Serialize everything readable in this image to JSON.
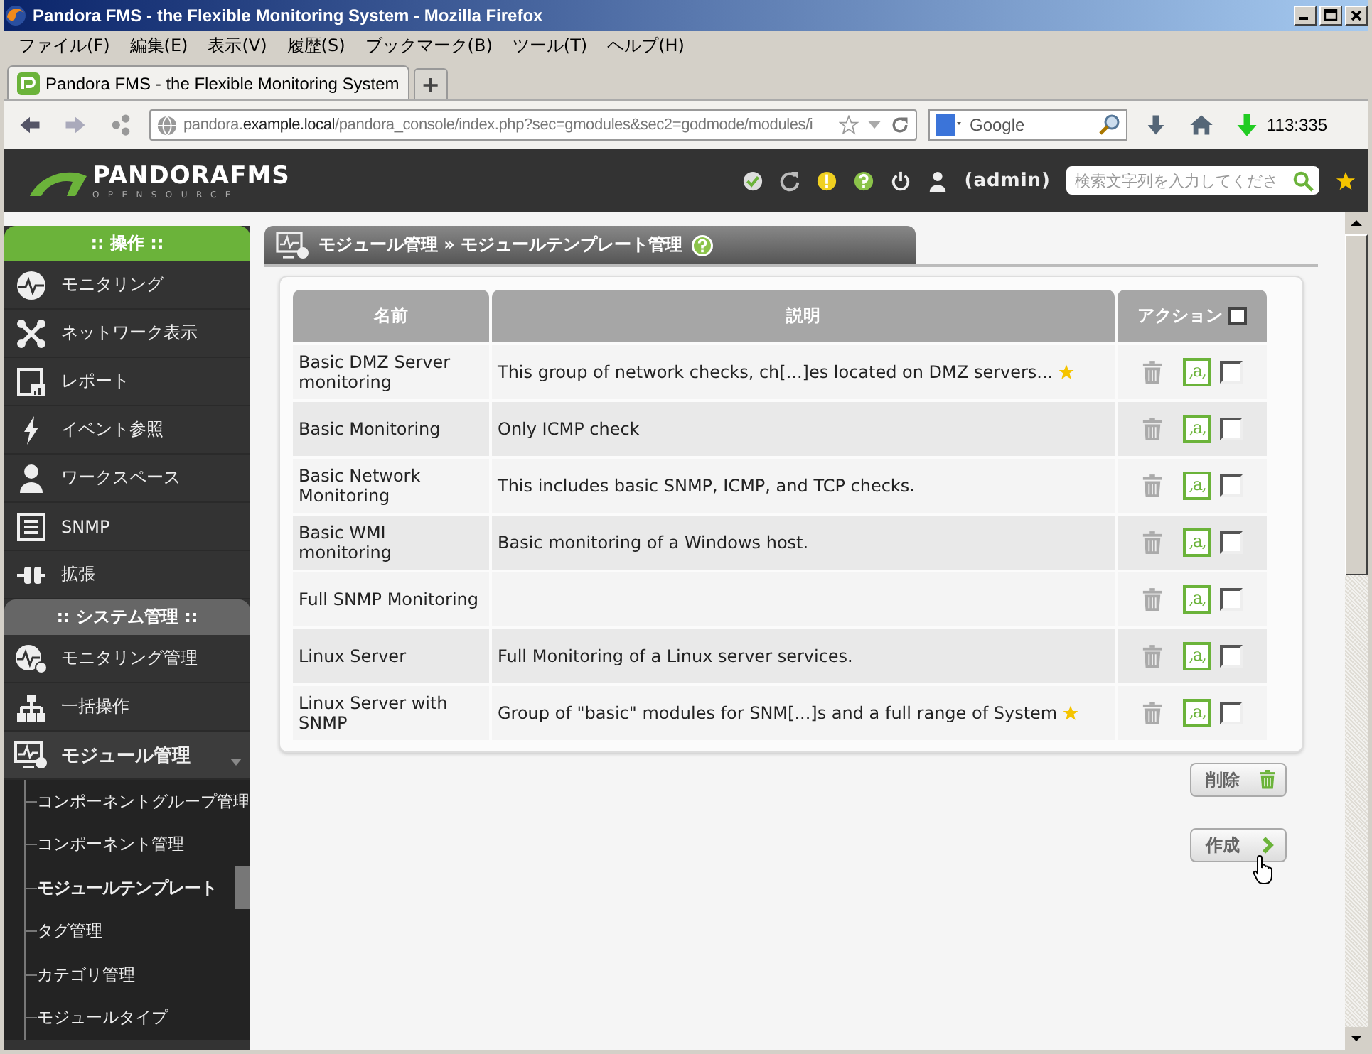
{
  "window": {
    "title": "Pandora FMS - the Flexible Monitoring System - Mozilla Firefox"
  },
  "menu_bar": [
    "ファイル(F)",
    "編集(E)",
    "表示(V)",
    "履歴(S)",
    "ブックマーク(B)",
    "ツール(T)",
    "ヘルプ(H)"
  ],
  "tabs": [
    {
      "label": "Pandora FMS - the Flexible Monitoring System",
      "selected": true
    }
  ],
  "new_tab": "+",
  "address_bar": {
    "prefix": "pandora.",
    "domain": "example.local",
    "path": "/pandora_console/index.php?sec=gmodules&sec2=godmode/modules/i"
  },
  "search_bar": {
    "placeholder": "Google"
  },
  "counter": "113:335",
  "header": {
    "logo": "PANDORAFMS",
    "logo_sub": "OPENSOURCE",
    "user": "(admin)",
    "search_placeholder": "検索文字列を入力してくださ"
  },
  "sidebar": [
    {
      "title": ":: 操作 ::",
      "selected": true,
      "items": [
        {
          "label": "モニタリング",
          "expanded": false
        },
        {
          "label": "ネットワーク表示",
          "expanded": false
        },
        {
          "label": "レポート",
          "expanded": false
        },
        {
          "label": "イベント参照",
          "expanded": false
        },
        {
          "label": "ワークスペース",
          "expanded": false
        },
        {
          "label": "SNMP",
          "expanded": false
        },
        {
          "label": "拡張",
          "expanded": false
        }
      ]
    },
    {
      "title": ":: システム管理 ::",
      "selected": false,
      "items": [
        {
          "label": "モニタリング管理",
          "expanded": false
        },
        {
          "label": "一括操作",
          "expanded": false
        },
        {
          "label": "モジュール管理",
          "expanded": true,
          "children": [
            {
              "label": "コンポーネントグループ管理",
              "selected": false
            },
            {
              "label": "コンポーネント管理",
              "selected": false
            },
            {
              "label": "モジュールテンプレート",
              "selected": true
            },
            {
              "label": "タグ管理",
              "selected": false
            },
            {
              "label": "カテゴリ管理",
              "selected": false
            },
            {
              "label": "モジュールタイプ",
              "selected": false
            }
          ]
        }
      ]
    }
  ],
  "page_title": "モジュール管理 » モジュールテンプレート管理",
  "table": {
    "columns": [
      "名前",
      "説明",
      "アクション"
    ],
    "select_all_checked": false,
    "rows": [
      {
        "name": "Basic DMZ Server monitoring",
        "description": "This group of network checks, ch[...]es located on DMZ servers...",
        "star": true,
        "edit": ",a,",
        "checked": false
      },
      {
        "name": "Basic Monitoring",
        "description": "Only ICMP check",
        "star": false,
        "edit": ",a,",
        "checked": false
      },
      {
        "name": "Basic Network Monitoring",
        "description": "This includes basic SNMP, ICMP, and TCP checks.",
        "star": false,
        "edit": ",a,",
        "checked": false
      },
      {
        "name": "Basic WMI monitoring",
        "description": "Basic monitoring of a Windows host.",
        "star": false,
        "edit": ",a,",
        "checked": false
      },
      {
        "name": "Full SNMP Monitoring",
        "description": "",
        "star": false,
        "edit": ",a,",
        "checked": false
      },
      {
        "name": "Linux Server",
        "description": "Full Monitoring of a Linux server services.",
        "star": false,
        "edit": ",a,",
        "checked": false
      },
      {
        "name": "Linux Server with SNMP",
        "description": "Group of \"basic\" modules for SNM[...]s and a full range of System",
        "star": true,
        "edit": ",a,",
        "checked": false
      }
    ]
  },
  "buttons": [
    {
      "label": "削除",
      "kind": "delete"
    },
    {
      "label": "作成",
      "kind": "create"
    }
  ]
}
